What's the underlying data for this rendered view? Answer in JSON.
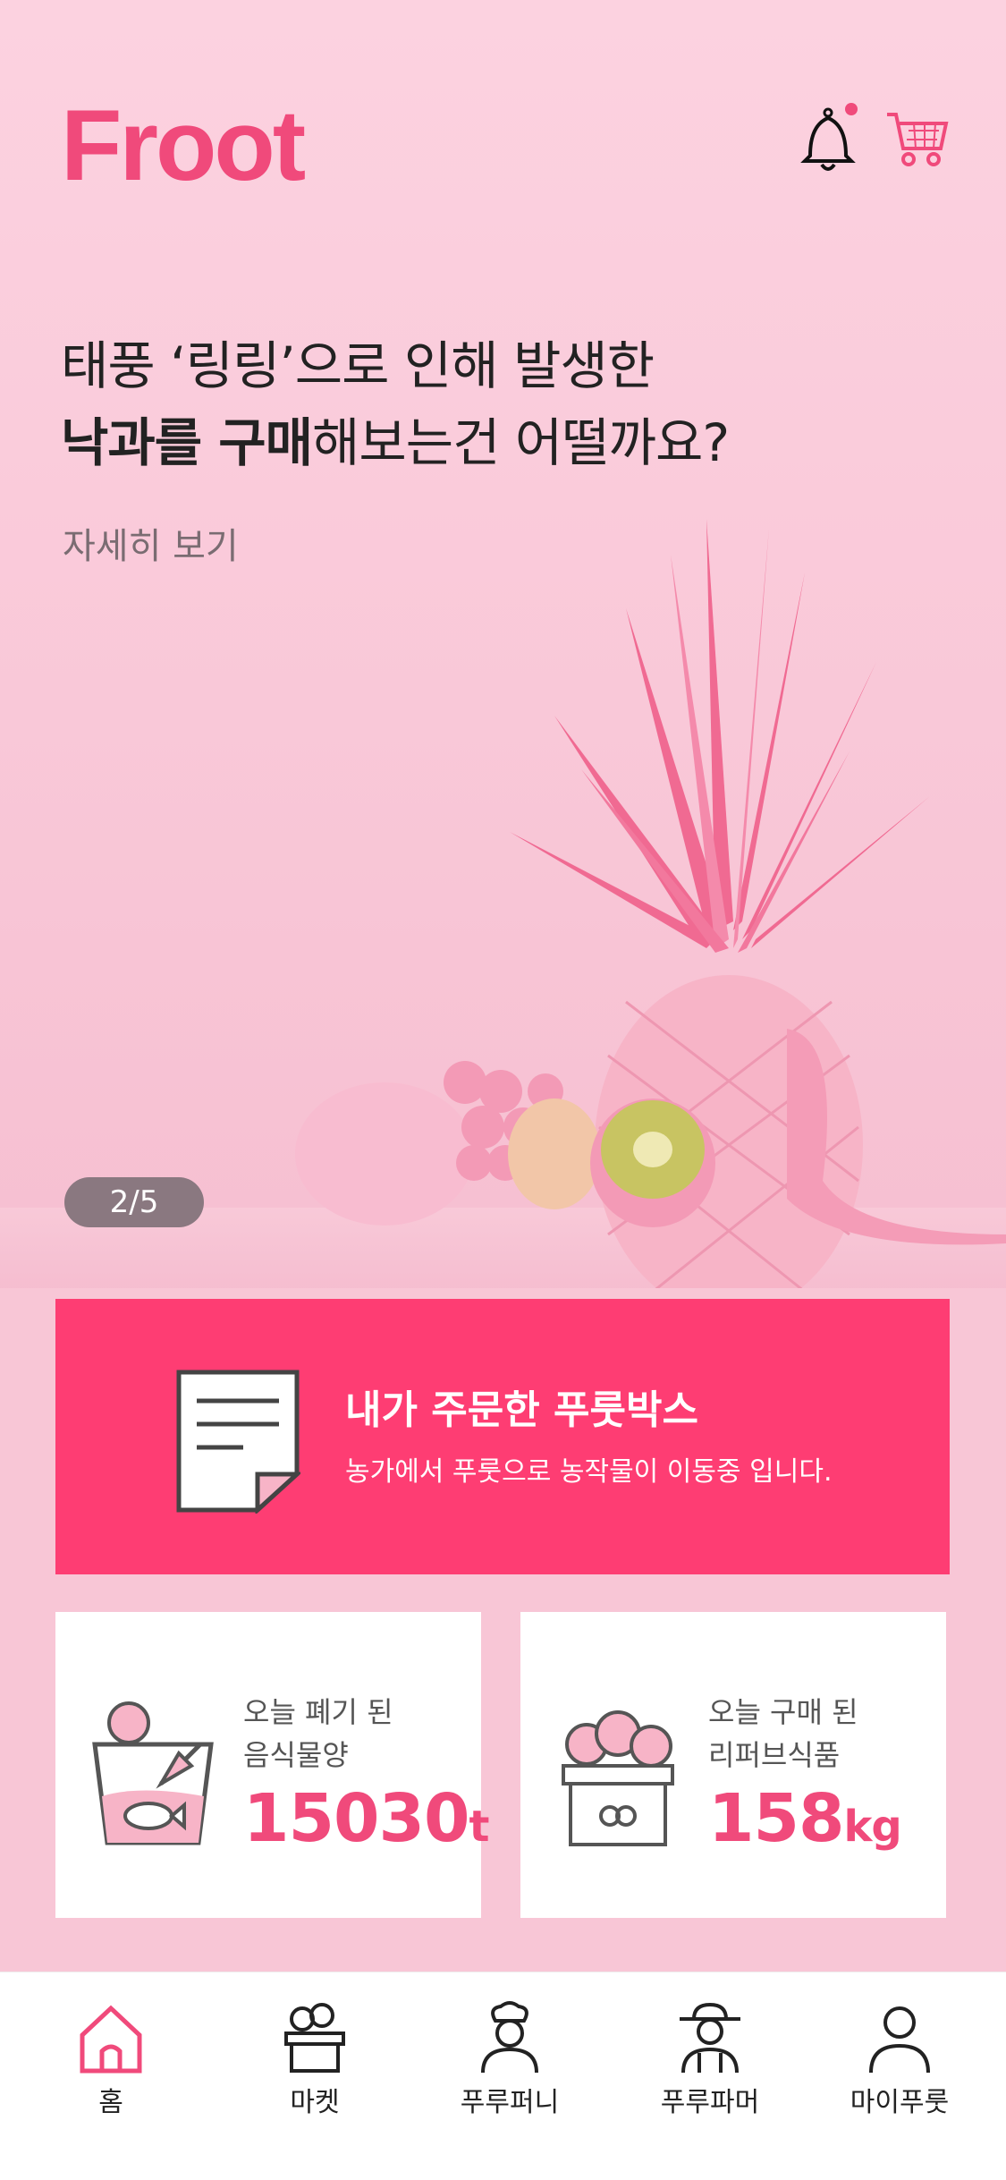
{
  "header": {
    "logo_text": "Froot",
    "bell_icon": "bell-icon",
    "cart_icon": "cart-icon",
    "notification_dot_color": "#f04a7b"
  },
  "banner": {
    "line1": "태풍 ‘링링’으로 인해 발생한",
    "line2_bold": "낙과를 구매",
    "line2_rest": "해보는건 어떨까요?",
    "more_link": "자세히 보기",
    "pager": "2/5"
  },
  "order": {
    "icon": "document-icon",
    "title": "내가 주문한 푸룻박스",
    "description": "농가에서 푸룻으로 농작물이 이동중 입니다."
  },
  "stats": [
    {
      "icon": "food-waste-icon",
      "label": "오늘 폐기 된\n음식물양",
      "value": "15030",
      "unit": "t"
    },
    {
      "icon": "produce-box-icon",
      "label": "오늘 구매 된\n리퍼브식품",
      "value": "158",
      "unit": "kg"
    }
  ],
  "tabbar": {
    "tabs": [
      {
        "icon": "home-icon",
        "label": "홈",
        "active": true
      },
      {
        "icon": "market-icon",
        "label": "마켓",
        "active": false
      },
      {
        "icon": "chef-icon",
        "label": "푸루퍼니",
        "active": false
      },
      {
        "icon": "farmer-icon",
        "label": "푸루파머",
        "active": false
      },
      {
        "icon": "user-icon",
        "label": "마이푸룻",
        "active": false
      }
    ]
  },
  "colors": {
    "accent": "#f04a7b",
    "order_card": "#fe3d73",
    "background": "#f8c6d6"
  }
}
